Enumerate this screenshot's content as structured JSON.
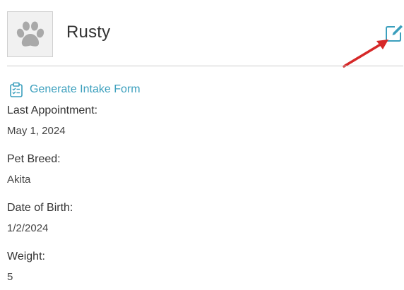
{
  "pet": {
    "name": "Rusty"
  },
  "actions": {
    "intake_label": "Generate Intake Form"
  },
  "fields": [
    {
      "label": "Last Appointment:",
      "value": "May 1, 2024"
    },
    {
      "label": "Pet Breed:",
      "value": "Akita"
    },
    {
      "label": "Date of Birth:",
      "value": "1/2/2024"
    },
    {
      "label": "Weight:",
      "value": "5"
    }
  ],
  "colors": {
    "accent": "#3b9fbd",
    "annotation_arrow": "#d62828",
    "divider": "#cccccc",
    "avatar_bg": "#f1f1f1"
  },
  "icons": {
    "avatar": "paw-icon",
    "edit": "edit-icon",
    "intake": "clipboard-icon"
  }
}
